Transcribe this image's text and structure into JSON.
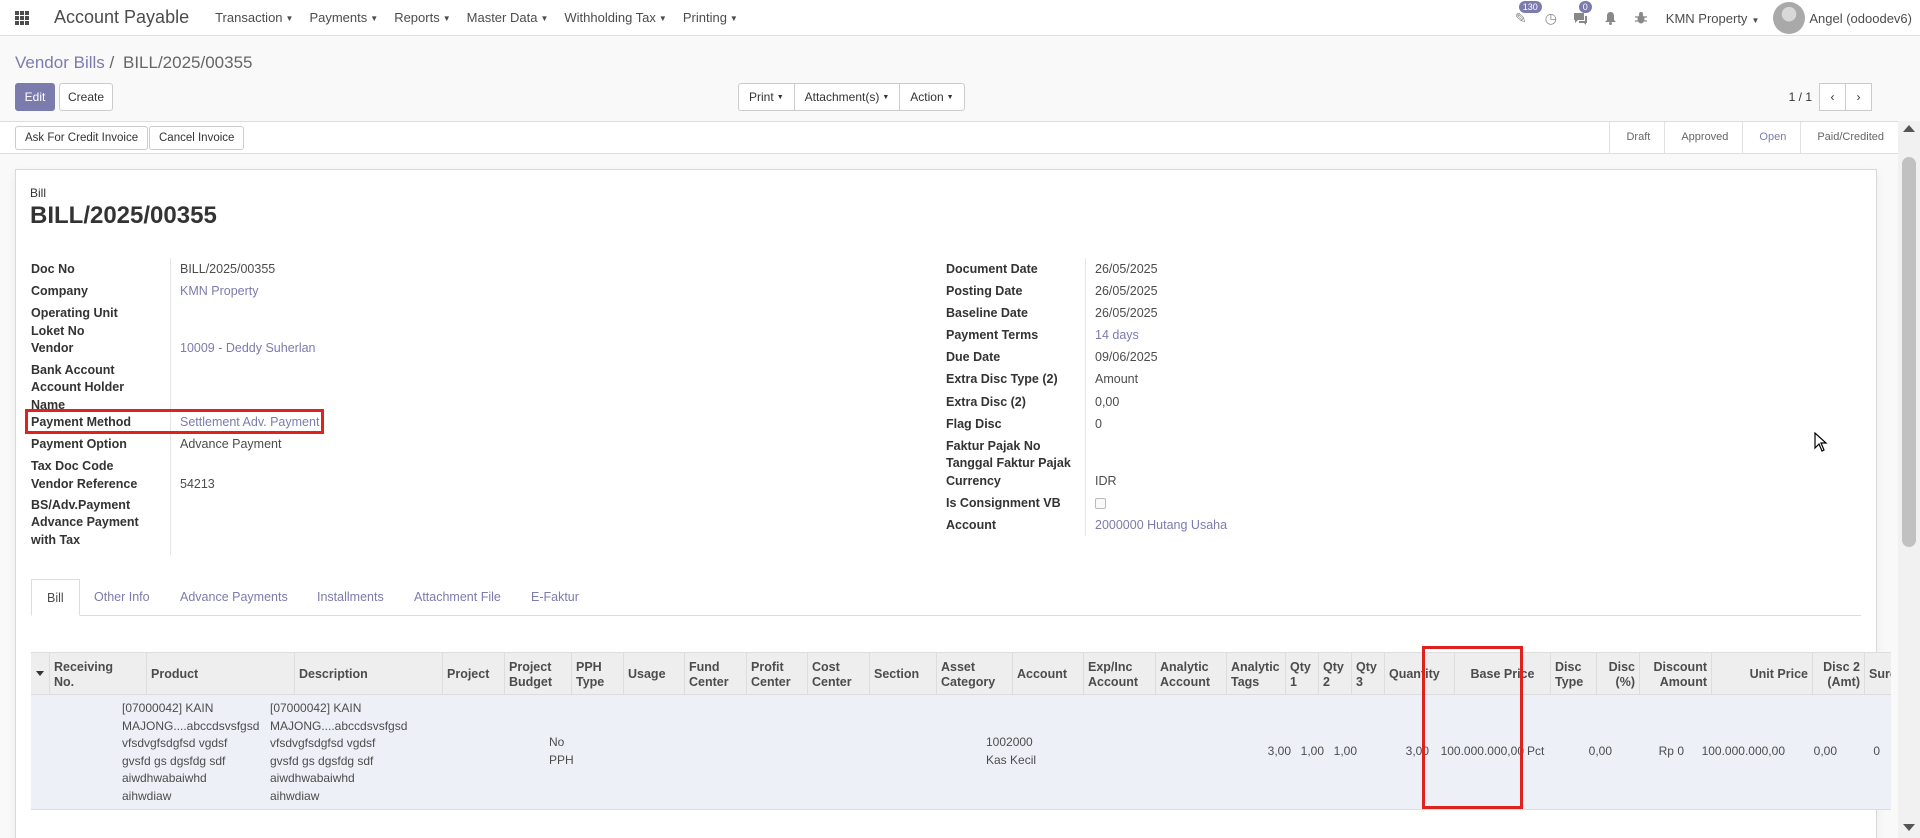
{
  "navbar": {
    "app_title": "Account Payable",
    "menus": [
      "Transaction",
      "Payments",
      "Reports",
      "Master Data",
      "Withholding Tax",
      "Printing"
    ],
    "activity_badge": "130",
    "messages_badge": "0",
    "company": "KMN Property",
    "user": "Angel (odoodev6)"
  },
  "breadcrumb": {
    "parent": "Vendor Bills",
    "separator": "/",
    "current": "BILL/2025/00355"
  },
  "toolbar": {
    "edit": "Edit",
    "create": "Create",
    "print": "Print",
    "attachments": "Attachment(s)",
    "action": "Action",
    "pager": "1 / 1",
    "prev": "‹",
    "next": "›"
  },
  "statusbar": {
    "ask_credit": "Ask For Credit Invoice",
    "cancel_invoice": "Cancel Invoice",
    "stages": [
      "Draft",
      "Approved",
      "Open",
      "Paid/Credited"
    ],
    "active_stage": "Open"
  },
  "form": {
    "doc_type": "Bill",
    "title": "BILL/2025/00355",
    "left": {
      "doc_no_label": "Doc No",
      "doc_no": "BILL/2025/00355",
      "company_label": "Company",
      "company": "KMN Property",
      "operating_unit_label": "Operating Unit",
      "loket_no_label": "Loket No",
      "vendor_label": "Vendor",
      "vendor": "10009 - Deddy Suherlan",
      "bank_account_label": "Bank Account",
      "account_holder_label": "Account Holder",
      "account_holder_label2": "Name",
      "payment_method_label": "Payment Method",
      "payment_method": "Settlement Adv. Payment",
      "payment_option_label": "Payment Option",
      "payment_option": "Advance Payment",
      "tax_doc_code_label": "Tax Doc Code",
      "vendor_reference_label": "Vendor Reference",
      "vendor_reference": "54213",
      "bs_adv_label": "BS/Adv.Payment",
      "adv_tax_label": "Advance Payment",
      "adv_tax_label2": "with Tax"
    },
    "right": {
      "document_date_label": "Document Date",
      "document_date": "26/05/2025",
      "posting_date_label": "Posting Date",
      "posting_date": "26/05/2025",
      "baseline_date_label": "Baseline Date",
      "baseline_date": "26/05/2025",
      "payment_terms_label": "Payment Terms",
      "payment_terms": "14 days",
      "due_date_label": "Due Date",
      "due_date": "09/06/2025",
      "extra_disc_type_label": "Extra Disc Type (2)",
      "extra_disc_type": "Amount",
      "extra_disc_label": "Extra Disc (2)",
      "extra_disc": "0,00",
      "flag_disc_label": "Flag Disc",
      "flag_disc": "0",
      "faktur_no_label": "Faktur Pajak No",
      "faktur_date_label": "Tanggal Faktur Pajak",
      "currency_label": "Currency",
      "currency": "IDR",
      "consignment_label": "Is Consignment VB",
      "account_label": "Account",
      "account": "2000000 Hutang Usaha"
    }
  },
  "tabs": [
    "Bill",
    "Other Info",
    "Advance Payments",
    "Installments",
    "Attachment File",
    "E-Faktur"
  ],
  "table": {
    "headers": [
      "Receiving\nNo.",
      "Product",
      "Description",
      "Project",
      "Project\nBudget",
      "PPH\nType",
      "Usage",
      "Fund\nCenter",
      "Profit\nCenter",
      "Cost\nCenter",
      "Section",
      "Asset\nCategory",
      "Account",
      "Exp/Inc\nAccount",
      "Analytic\nAccount",
      "Analytic\nTags",
      "Qty\n1",
      "Qty\n2",
      "Qty\n3",
      "Quantity",
      "Base Price",
      "Disc\nType",
      "Disc\n(%)",
      "Discount\nAmount",
      "Unit Price",
      "Disc 2\n(Amt)",
      "Surcharge"
    ],
    "row": {
      "product": "[07000042] KAIN\nMAJONG....abccdsvsfgsd\nvfsdvgfsdgfsd vgdsf\ngvsfd gs dgsfdg sdf\naiwdhwabaiwhd\naihwdiaw",
      "description": "[07000042] KAIN\nMAJONG....abccdsvsfgsd\nvfsdvgfsdgfsd vgdsf\ngvsfd gs dgsfdg sdf\naiwdhwabaiwhd\naihwdiaw",
      "pph_type": "No\nPPH",
      "account": "1002000\nKas Kecil",
      "qty1": "3,00",
      "qty2": "1,00",
      "qty3": "1,00",
      "quantity": "3,00",
      "base_price": "100.000.000,00",
      "disc_type": "Pct",
      "disc_pct": "0,00",
      "discount_amount": "Rp 0",
      "unit_price": "100.000.000,00",
      "disc2": "0,00",
      "surcharge": "0"
    }
  },
  "colors": {
    "accent": "#7c7bad",
    "highlight": "#e0221f"
  }
}
